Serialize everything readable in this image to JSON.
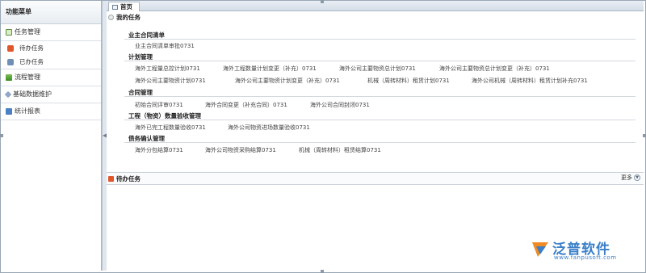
{
  "sidebar": {
    "title": "功能菜单",
    "groups": [
      {
        "label": "任务管理",
        "icon": "task-icon"
      },
      {
        "label": "流程管理",
        "icon": "flow-icon"
      },
      {
        "label": "基础数据维护",
        "icon": "base-data-icon"
      },
      {
        "label": "统计报表",
        "icon": "report-icon"
      }
    ],
    "sub_items": [
      {
        "label": "待办任务",
        "icon": "todo-icon"
      },
      {
        "label": "已办任务",
        "icon": "done-icon"
      }
    ]
  },
  "tabs": [
    {
      "label": "首页",
      "icon": "home-icon"
    }
  ],
  "my_tasks": {
    "title": "我的任务",
    "sections": [
      {
        "title": "业主合同清单",
        "items": [
          "业主合同清单审批0731"
        ]
      },
      {
        "title": "计划管理",
        "items": [
          "海外工程量总控计划0731",
          "海外工程数量计划变更（补充）0731",
          "海外公司主要物资总计划0731",
          "海外公司主要物资总计划变更（补充）0731",
          "海外公司主要物资计划0731",
          "海外公司主要物资计划变更（补充）0731",
          "机械（周转材料）租赁计划0731",
          "海外公司机械（周转材料）租赁计划补充0731"
        ]
      },
      {
        "title": "合同管理",
        "items": [
          "初始合同评审0731",
          "海外合同变更（补充合同）0731",
          "海外公司合同封闭0731"
        ]
      },
      {
        "title": "工程（物资）数量验收管理",
        "items": [
          "海外已完工程数量验收0731",
          "海外公司物资进场数量验收0731"
        ]
      },
      {
        "title": "债务确认管理",
        "items": [
          "海外分包结算0731",
          "海外公司物资采购结算0731",
          "机械（周转材料）租赁结算0731"
        ]
      }
    ]
  },
  "todo_tasks": {
    "title": "待办任务",
    "more_label": "更多"
  },
  "logo": {
    "name": "泛普软件",
    "url": "www.fanpusoft.com"
  }
}
